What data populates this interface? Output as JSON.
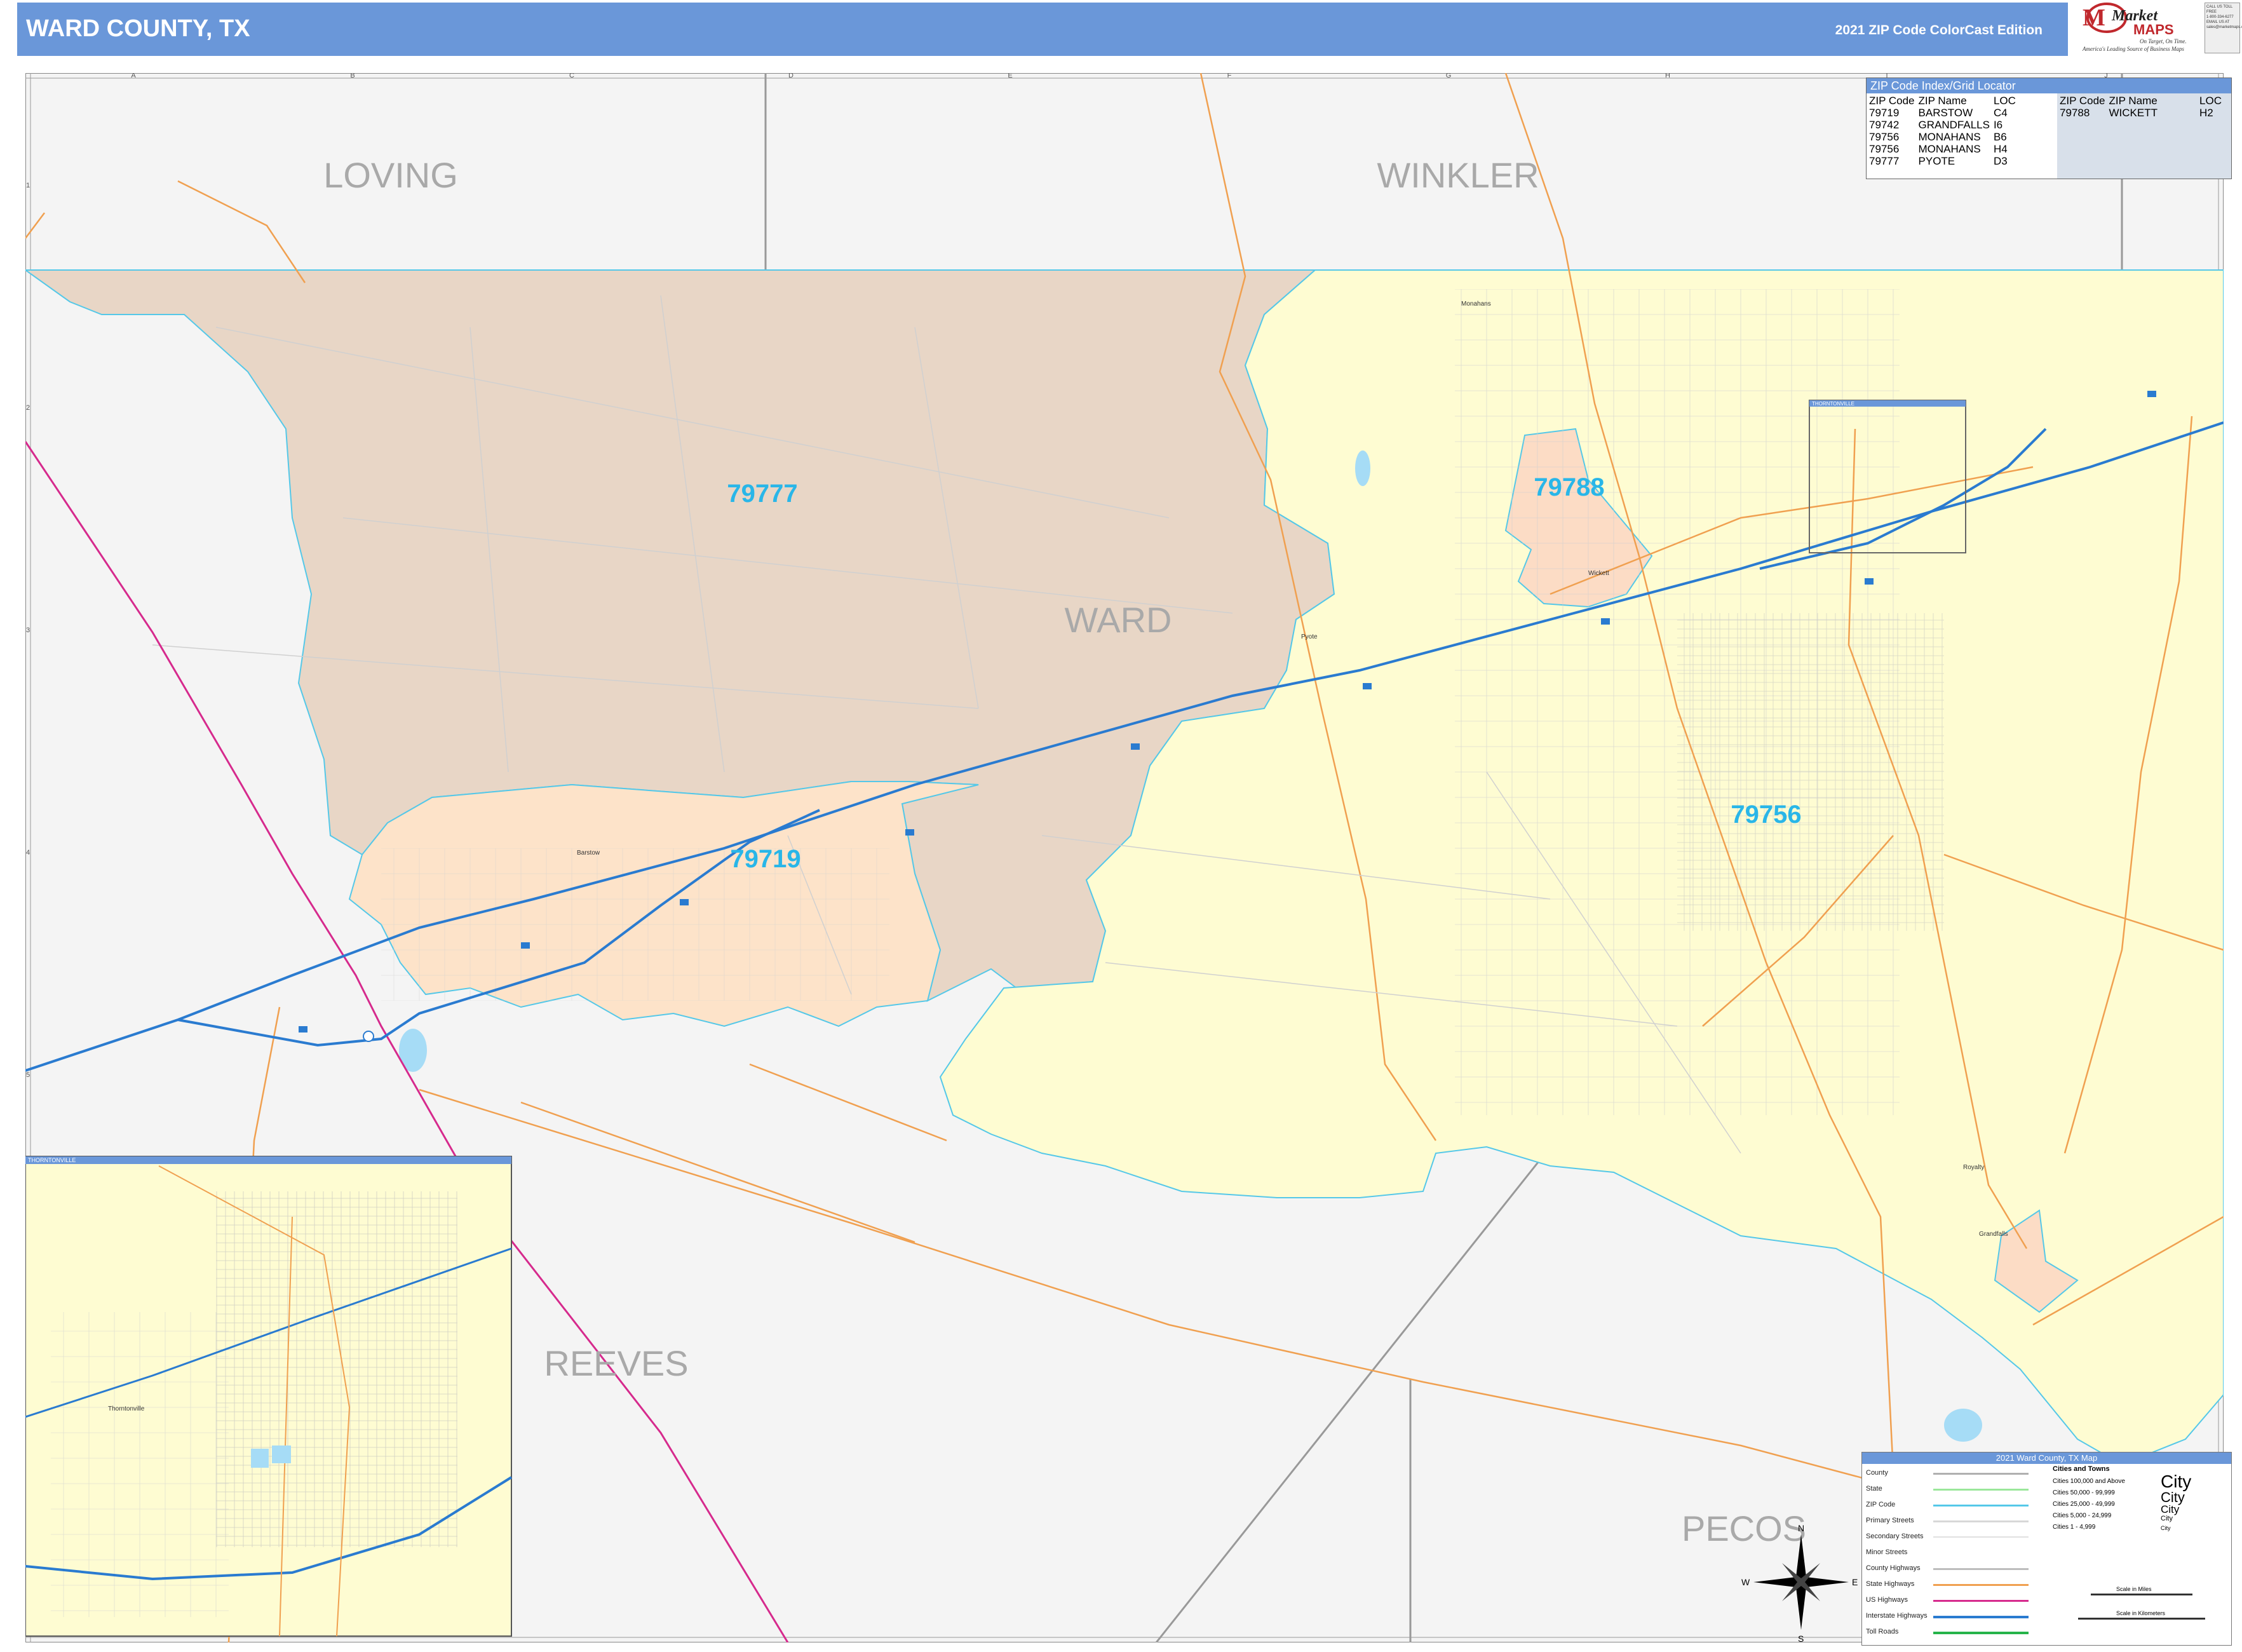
{
  "header": {
    "title": "WARD COUNTY, TX",
    "edition": "2021 ZIP Code ColorCast Edition"
  },
  "logo": {
    "brand_top": "Market",
    "brand_bottom": "MAPS",
    "tagline1": "On Target, On Time.",
    "tagline2": "America's Leading Source of Business Maps",
    "box_text": [
      "CALL US TOLL FREE",
      "1-800-334-6277",
      "EMAIL US AT",
      "sales@marketmaps.com"
    ]
  },
  "grid": {
    "letters": [
      "A",
      "B",
      "C",
      "D",
      "E",
      "F",
      "G",
      "H",
      "I",
      "J"
    ],
    "numbers": [
      "1",
      "2",
      "3",
      "4",
      "5",
      "6",
      "7"
    ]
  },
  "counties": {
    "loving": "LOVING",
    "winkler": "WINKLER",
    "ward": "WARD",
    "reeves": "REEVES",
    "pecos": "PECOS"
  },
  "zip_labels": {
    "z79777": "79777",
    "z79788": "79788",
    "z79756": "79756",
    "z79719": "79719"
  },
  "places": {
    "monahans": "Monahans",
    "pyote": "Pyote",
    "barstow": "Barstow",
    "wickett": "Wickett",
    "royalty": "Royalty",
    "grandfalls": "Grandfalls",
    "thorntonville": "Thorntonville"
  },
  "inset": {
    "title": "THORNTONVILLE",
    "small_box_title": "THORNTONVILLE"
  },
  "zip_index": {
    "title": "ZIP Code Index/Grid Locator",
    "headers": [
      "ZIP Code",
      "ZIP Name",
      "LOC"
    ],
    "rows_left": [
      [
        "79719",
        "BARSTOW",
        "C4"
      ],
      [
        "79742",
        "GRANDFALLS",
        "I6"
      ],
      [
        "79756",
        "MONAHANS",
        "B6"
      ],
      [
        "79756",
        "MONAHANS",
        "H4"
      ],
      [
        "79777",
        "PYOTE",
        "D3"
      ]
    ],
    "rows_right": [
      [
        "79788",
        "WICKETT",
        "H2"
      ]
    ]
  },
  "legend": {
    "title": "2021 Ward County, TX Map",
    "rows": [
      "County",
      "State",
      "ZIP Code",
      "Primary Streets",
      "Secondary Streets",
      "Minor Streets",
      "County Highways",
      "State Highways",
      "US Highways",
      "Interstate Highways",
      "Toll Roads"
    ],
    "cities_header": "Cities and Towns",
    "city_rows": [
      "Cities 100,000 and Above",
      "Cities 50,000 - 99,999",
      "Cities 25,000 - 49,999",
      "Cities 5,000 - 24,999",
      "Cities 1 - 4,999"
    ],
    "city_samples": [
      "City",
      "City",
      "City",
      "City",
      "City"
    ],
    "scale_miles": "Scale in Miles",
    "scale_km": "Scale in Kilometers",
    "compass": [
      "N",
      "S",
      "E",
      "W"
    ]
  },
  "colors": {
    "header": "#6a97d9",
    "zip_79777": "#e8d6c6",
    "zip_79756": "#fefcd2",
    "zip_79719": "#fde3c9",
    "zip_79788": "#fcdcc5",
    "zip_label": "#29b6e8",
    "outside": "#f4f4f4",
    "interstate": "#2a7bd0",
    "us_highway": "#d62a8d",
    "state_highway": "#f0a050",
    "zip_boundary": "#55c8e8"
  }
}
